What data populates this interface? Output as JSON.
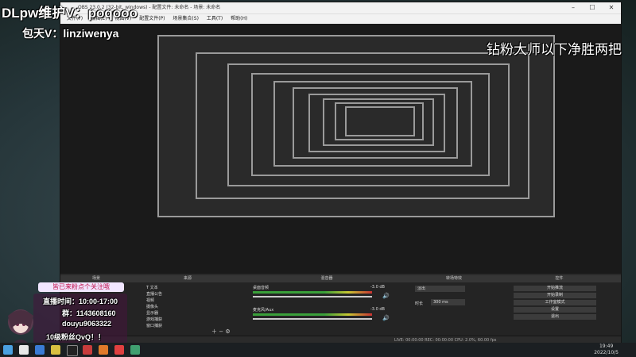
{
  "overlay": {
    "room_text": "DLpw维护V：poqooo",
    "contact_text": "包天V：linziwenya",
    "banner_text": "钻粉大师以下净胜两把"
  },
  "info_card": {
    "title": "皆已来粉点个关注哦",
    "time": "直播时间：10:00-17:00",
    "group": "群：1143608160",
    "douyu": "douyu9063322",
    "fans": "10级粉丝QvQ！！"
  },
  "obs": {
    "title": "OBS 23.0.2 (32-bit, windows) - 配置文件: 未命名 - 场景: 未命名",
    "menu": [
      "文件(F)",
      "编辑(E)",
      "视图(V)",
      "配置文件(P)",
      "场景集合(S)",
      "工具(T)",
      "帮助(H)"
    ],
    "docks": {
      "scenes": "场景",
      "sources": "来源",
      "mixer": "混音器",
      "transitions": "转场特效",
      "controls": "控件"
    },
    "sources": [
      "T 文本",
      "直播公告",
      "视频",
      "摄像头",
      "显示器",
      "游戏捕获",
      "窗口捕获"
    ],
    "mixer": [
      {
        "name": "桌面音频",
        "db": "-3.0 dB"
      },
      {
        "name": "麦克风/Aux",
        "db": "-3.0 dB"
      }
    ],
    "transition": {
      "type": "淡出",
      "duration_label": "时长",
      "duration": "300 ms"
    },
    "controls": [
      "开始推流",
      "开始录制",
      "工作室模式",
      "设置",
      "退出"
    ],
    "status": "LIVE: 00:00:00   REC: 00:00:00   CPU: 2.0%, 60.00 fps"
  },
  "taskbar": {
    "time": "19:49",
    "date": "2022/10/5"
  },
  "colors": {
    "accent_red": "#c0104a",
    "obs_bg": "#2b2b2b",
    "mixer_green": "#3aa03a"
  }
}
